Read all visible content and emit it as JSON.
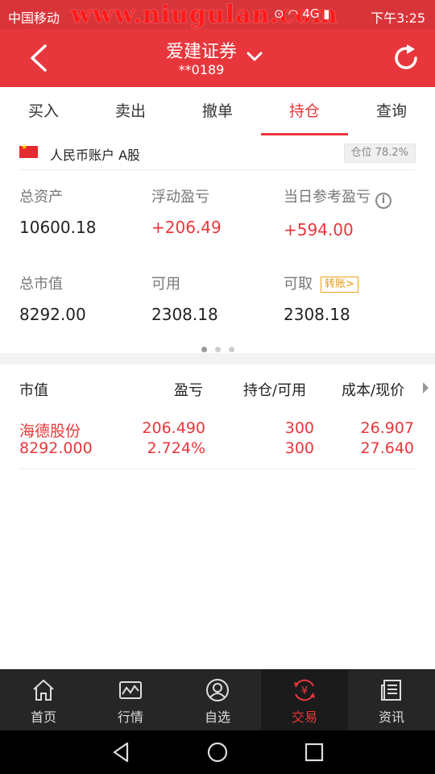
{
  "status_bar": {
    "carrier": "中国移动",
    "watermark": "www.niugulan.com",
    "icons": "⊙ ◠ 4G ▮",
    "time": "下午3:25"
  },
  "header": {
    "title": "爱建证券",
    "account": "**0189"
  },
  "tabs": [
    {
      "label": "买入"
    },
    {
      "label": "卖出"
    },
    {
      "label": "撤单"
    },
    {
      "label": "持仓",
      "active": true
    },
    {
      "label": "查询"
    }
  ],
  "account_row": {
    "label": "人民币账户 A股",
    "position_ratio": "仓位 78.2%"
  },
  "summary": {
    "total_assets": {
      "label": "总资产",
      "value": "10600.18"
    },
    "floating_pnl": {
      "label": "浮动盈亏",
      "value": "+206.49"
    },
    "today_pnl": {
      "label": "当日参考盈亏",
      "value": "+594.00"
    },
    "market_value": {
      "label": "总市值",
      "value": "8292.00"
    },
    "available": {
      "label": "可用",
      "value": "2308.18"
    },
    "withdrawable": {
      "label": "可取",
      "value": "2308.18",
      "transfer_label": "转账>"
    }
  },
  "holdings": {
    "headers": {
      "market_value": "市值",
      "pnl": "盈亏",
      "position": "持仓/可用",
      "cost_price": "成本/现价"
    },
    "rows": [
      {
        "name": "海德股份",
        "market_value": "8292.000",
        "pnl": "206.490",
        "pnl_pct": "2.724%",
        "position": "300",
        "available": "300",
        "cost": "26.907",
        "price": "27.640"
      }
    ]
  },
  "bottom_nav": [
    {
      "label": "首页",
      "icon": "home-icon"
    },
    {
      "label": "行情",
      "icon": "chart-icon"
    },
    {
      "label": "自选",
      "icon": "user-icon"
    },
    {
      "label": "交易",
      "icon": "yuan-icon",
      "active": true
    },
    {
      "label": "资讯",
      "icon": "news-icon"
    }
  ],
  "colors": {
    "brand_red": "#e8373c",
    "gain_red": "#e8373c",
    "transfer_orange": "#e79a10"
  }
}
